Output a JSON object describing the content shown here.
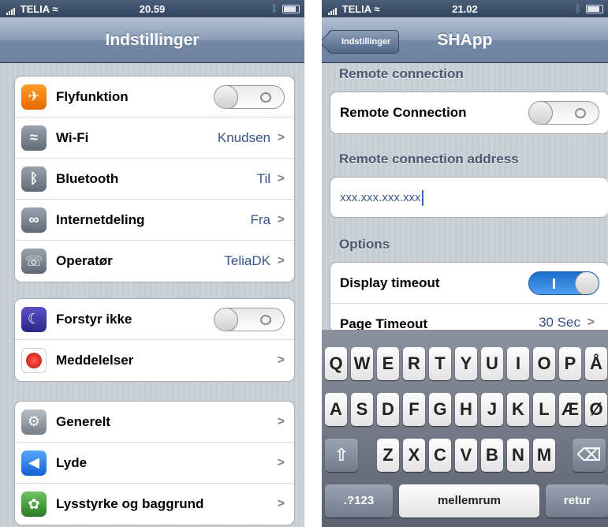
{
  "left": {
    "status": {
      "carrier": "TELIA",
      "time": "20.59"
    },
    "nav": {
      "title": "Indstillinger"
    },
    "group1": [
      {
        "label": "Flyfunktion",
        "icon": "airplane-icon",
        "type": "switch",
        "on": false
      },
      {
        "label": "Wi-Fi",
        "icon": "wifi-icon",
        "value": "Knudsen"
      },
      {
        "label": "Bluetooth",
        "icon": "bluetooth-icon",
        "value": "Til"
      },
      {
        "label": "Internetdeling",
        "icon": "link-icon",
        "value": "Fra"
      },
      {
        "label": "Operatør",
        "icon": "phone-icon",
        "value": "TeliaDK"
      }
    ],
    "group2": [
      {
        "label": "Forstyr ikke",
        "icon": "moon-icon",
        "type": "switch",
        "on": false
      },
      {
        "label": "Meddelelser",
        "icon": "notification-icon"
      }
    ],
    "group3": [
      {
        "label": "Generelt",
        "icon": "gear-icon"
      },
      {
        "label": "Lyde",
        "icon": "speaker-icon"
      },
      {
        "label": "Lysstyrke og baggrund",
        "icon": "flower-icon"
      }
    ]
  },
  "right": {
    "status": {
      "carrier": "TELIA",
      "time": "21.02"
    },
    "nav": {
      "title": "SHApp",
      "back": "Indstillinger"
    },
    "section_remote": "Remote connection",
    "remote_connection": {
      "label": "Remote Connection",
      "on": false
    },
    "section_address": "Remote connection address",
    "address_value": "xxx.xxx.xxx.xxx",
    "section_options": "Options",
    "display_timeout": {
      "label": "Display timeout",
      "on": true
    },
    "page_timeout": {
      "label": "Page Timeout",
      "value": "30 Sec"
    },
    "keyboard": {
      "row1": [
        "Q",
        "W",
        "E",
        "R",
        "T",
        "Y",
        "U",
        "I",
        "O",
        "P",
        "Å"
      ],
      "row2": [
        "A",
        "S",
        "D",
        "F",
        "G",
        "H",
        "J",
        "K",
        "L",
        "Æ",
        "Ø"
      ],
      "row3": [
        "Z",
        "X",
        "C",
        "V",
        "B",
        "N",
        "M"
      ],
      "shift": "⇧",
      "backspace": "⌫",
      "numbers": ".?123",
      "space": "mellemrum",
      "return": "retur"
    }
  }
}
